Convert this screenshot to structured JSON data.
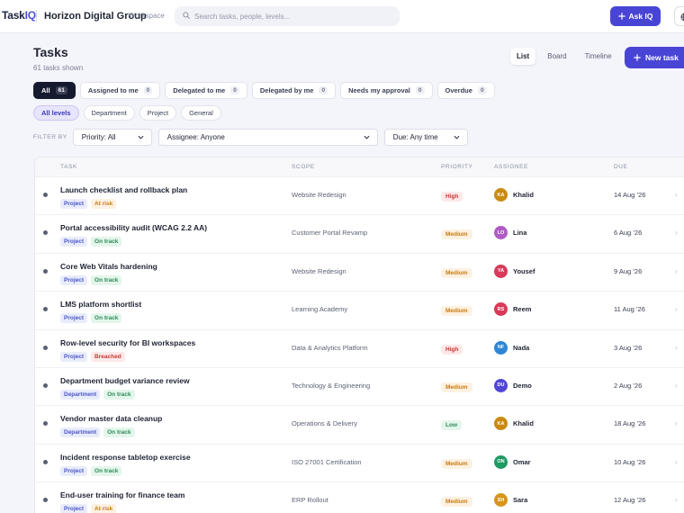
{
  "app": {
    "logo_main": "Task",
    "logo_accent": "IQ",
    "org_name": "Horizon Digital Group",
    "org_tag": "Workspace"
  },
  "search": {
    "placeholder": "Search tasks, people, levels..."
  },
  "top_actions": {
    "ask_label": "Ask IQ"
  },
  "header": {
    "title": "Tasks",
    "subtitle": "61 tasks shown",
    "new_task_label": "New task"
  },
  "views": [
    {
      "label": "List",
      "active": true
    },
    {
      "label": "Board",
      "active": false
    },
    {
      "label": "Timeline",
      "active": false
    }
  ],
  "chips": [
    {
      "label": "All",
      "count": "61",
      "active": true
    },
    {
      "label": "Assigned to me",
      "count": "0",
      "active": false
    },
    {
      "label": "Delegated to me",
      "count": "0",
      "active": false
    },
    {
      "label": "Delegated by me",
      "count": "0",
      "active": false
    },
    {
      "label": "Needs my approval",
      "count": "0",
      "active": false
    },
    {
      "label": "Overdue",
      "count": "0",
      "active": false
    }
  ],
  "levels": [
    {
      "label": "All levels",
      "active": true
    },
    {
      "label": "Department",
      "active": false
    },
    {
      "label": "Project",
      "active": false
    },
    {
      "label": "General",
      "active": false
    }
  ],
  "filters": {
    "label": "FILTER BY",
    "priority": "Priority: All",
    "assignee": "Assignee: Anyone",
    "due": "Due: Any time"
  },
  "table": {
    "columns": {
      "task": "TASK",
      "scope": "SCOPE",
      "priority": "PRIORITY",
      "assignee": "ASSIGNEE",
      "due": "DUE"
    },
    "rows": [
      {
        "title": "Launch checklist and rollback plan",
        "level": "Project",
        "status": "At risk",
        "status_kind": "risk",
        "scope": "Website Redesign",
        "priority": "High",
        "assignee_initials": "KA",
        "assignee": "Khalid",
        "avatar_color": "#c98a12",
        "due": "14 Aug ’26"
      },
      {
        "title": "Portal accessibility audit (WCAG 2.2 AA)",
        "level": "Project",
        "status": "On track",
        "status_kind": "track",
        "scope": "Customer Portal Revamp",
        "priority": "Medium",
        "assignee_initials": "LO",
        "assignee": "Lina",
        "avatar_color": "#b05cc4",
        "due": "6 Aug ’26"
      },
      {
        "title": "Core Web Vitals hardening",
        "level": "Project",
        "status": "On track",
        "status_kind": "track",
        "scope": "Website Redesign",
        "priority": "Medium",
        "assignee_initials": "YA",
        "assignee": "Yousef",
        "avatar_color": "#d93a5b",
        "due": "9 Aug ’26"
      },
      {
        "title": "LMS platform shortlist",
        "level": "Project",
        "status": "On track",
        "status_kind": "track",
        "scope": "Learning Academy",
        "priority": "Medium",
        "assignee_initials": "RS",
        "assignee": "Reem",
        "avatar_color": "#d9395a",
        "due": "11 Aug ’26"
      },
      {
        "title": "Row-level security for BI workspaces",
        "level": "Project",
        "status": "Breached",
        "status_kind": "breach",
        "scope": "Data & Analytics Platform",
        "priority": "High",
        "assignee_initials": "NF",
        "assignee": "Nada",
        "avatar_color": "#2f86d6",
        "due": "3 Aug ’26"
      },
      {
        "title": "Department budget variance review",
        "level": "Department",
        "status": "On track",
        "status_kind": "track",
        "scope": "Technology & Engineering",
        "priority": "Medium",
        "assignee_initials": "DU",
        "assignee": "Demo",
        "avatar_color": "#5146d6",
        "due": "2 Aug ’26"
      },
      {
        "title": "Vendor master data cleanup",
        "level": "Department",
        "status": "On track",
        "status_kind": "track",
        "scope": "Operations & Delivery",
        "priority": "Low",
        "assignee_initials": "KA",
        "assignee": "Khalid",
        "avatar_color": "#c98a12",
        "due": "18 Aug ’26"
      },
      {
        "title": "Incident response tabletop exercise",
        "level": "Project",
        "status": "On track",
        "status_kind": "track",
        "scope": "ISO 27001 Certification",
        "priority": "Medium",
        "assignee_initials": "ON",
        "assignee": "Omar",
        "avatar_color": "#1f9a63",
        "due": "10 Aug ’26"
      },
      {
        "title": "End-user training for finance team",
        "level": "Project",
        "status": "At risk",
        "status_kind": "risk",
        "scope": "ERP Rollout",
        "priority": "Medium",
        "assignee_initials": "SH",
        "assignee": "Sara",
        "avatar_color": "#d8951c",
        "due": "12 Aug ’26"
      }
    ]
  }
}
